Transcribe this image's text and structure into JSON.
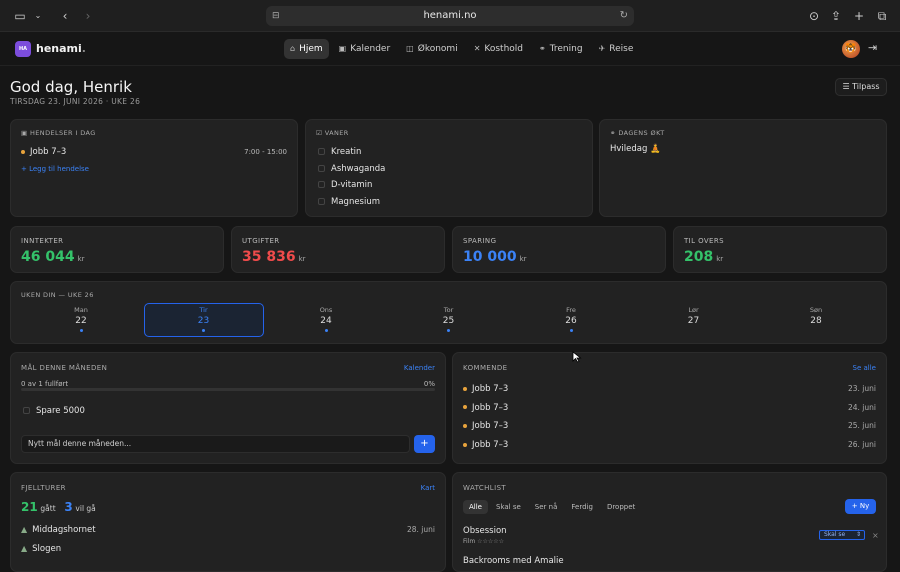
{
  "browser": {
    "url": "henami.no"
  },
  "app": {
    "brand": "henami",
    "logo_text": "HA",
    "avatar_emoji": "🐯",
    "nav": [
      {
        "label": "Hjem",
        "icon": "home-icon"
      },
      {
        "label": "Kalender",
        "icon": "calendar-icon"
      },
      {
        "label": "Økonomi",
        "icon": "wallet-icon"
      },
      {
        "label": "Kosthold",
        "icon": "food-icon"
      },
      {
        "label": "Trening",
        "icon": "dumbbell-icon"
      },
      {
        "label": "Reise",
        "icon": "plane-icon"
      }
    ]
  },
  "header": {
    "greeting": "God dag, Henrik",
    "date": "TIRSDAG 23. JUNI 2026 · UKE 26",
    "customize": "Tilpass"
  },
  "events": {
    "title": "HENDELSER I DAG",
    "items": [
      {
        "label": "Jobb 7–3",
        "time": "7:00 - 15:00"
      }
    ],
    "add": "+ Legg til hendelse"
  },
  "habits": {
    "title": "VANER",
    "items": [
      "Kreatin",
      "Ashwaganda",
      "D-vitamin",
      "Magnesium"
    ]
  },
  "workout": {
    "title": "DAGENS ØKT",
    "text": "Hviledag 🧘"
  },
  "stats": [
    {
      "label": "INNTEKTER",
      "value": "46 044",
      "unit": "kr",
      "color": "#34c26a"
    },
    {
      "label": "UTGIFTER",
      "value": "35 836",
      "unit": "kr",
      "color": "#f04b4b"
    },
    {
      "label": "SPARING",
      "value": "10 000",
      "unit": "kr",
      "color": "#3b82f6"
    },
    {
      "label": "TIL OVERS",
      "value": "208",
      "unit": "kr",
      "color": "#34c26a"
    }
  ],
  "week": {
    "title": "UKEN DIN — UKE 26",
    "days": [
      {
        "name": "Man",
        "num": "22",
        "dot": true
      },
      {
        "name": "Tir",
        "num": "23",
        "dot": true,
        "selected": true
      },
      {
        "name": "Ons",
        "num": "24",
        "dot": true
      },
      {
        "name": "Tor",
        "num": "25",
        "dot": true
      },
      {
        "name": "Fre",
        "num": "26",
        "dot": true
      },
      {
        "name": "Lør",
        "num": "27",
        "dot": false
      },
      {
        "name": "Søn",
        "num": "28",
        "dot": false
      }
    ]
  },
  "goals": {
    "title": "MÅL DENNE MÅNEDEN",
    "link": "Kalender",
    "progress_text": "0 av 1 fullført",
    "progress_pct": "0%",
    "progress": 0,
    "items": [
      "Spare 5000"
    ],
    "placeholder": "Nytt mål denne måneden...",
    "add": "+"
  },
  "upcoming": {
    "title": "KOMMENDE",
    "link": "Se alle",
    "items": [
      {
        "label": "Jobb 7–3",
        "date": "23. juni"
      },
      {
        "label": "Jobb 7–3",
        "date": "24. juni"
      },
      {
        "label": "Jobb 7–3",
        "date": "25. juni"
      },
      {
        "label": "Jobb 7–3",
        "date": "26. juni"
      }
    ]
  },
  "hikes": {
    "title": "FJELLTURER",
    "link": "Kart",
    "done_num": "21",
    "done_label": "gått",
    "todo_num": "3",
    "todo_label": "vil gå",
    "items": [
      {
        "label": "Middagshornet",
        "date": "28. juni"
      },
      {
        "label": "Slogen",
        "date": ""
      }
    ]
  },
  "watchlist": {
    "title": "WATCHLIST",
    "tabs": [
      "Alle",
      "Skal se",
      "Ser nå",
      "Ferdig",
      "Droppet"
    ],
    "new": "+ Ny",
    "items": [
      {
        "title": "Obsession",
        "type": "Film",
        "stars": "☆☆☆☆☆",
        "status": "Skal se"
      },
      {
        "title": "Backrooms med Amalie"
      }
    ]
  }
}
